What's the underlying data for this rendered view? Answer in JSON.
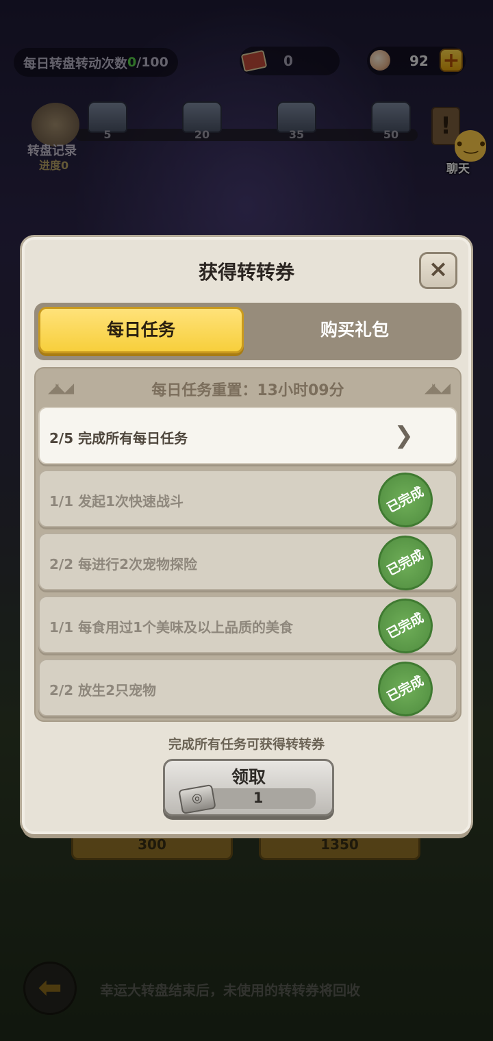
{
  "top_bar": {
    "spin_label": "每日转盘转动次数",
    "spin_current": "0",
    "spin_total": "/100",
    "ticket_count": "0",
    "gem_count": "92",
    "plus_label": "+"
  },
  "progress": {
    "record_label": "转盘记录",
    "record_sub": "进度0",
    "milestones": [
      "5",
      "20",
      "35",
      "50"
    ],
    "quest_icon": "!",
    "chat_label": "聊天"
  },
  "modal": {
    "title": "获得转转券",
    "close_label": "×",
    "tabs": [
      {
        "label": "每日任务",
        "active": true
      },
      {
        "label": "购买礼包",
        "active": false
      }
    ],
    "reset_text": "每日任务重置：13小时09分",
    "tasks": [
      {
        "text": "2/5  完成所有每日任务",
        "status": "arrow"
      },
      {
        "text": "1/1  发起1次快速战斗",
        "status": "已完成"
      },
      {
        "text": "2/2  每进行2次宠物探险",
        "status": "已完成"
      },
      {
        "text": "1/1  每食用过1个美味及以上品质的美食",
        "status": "已完成"
      },
      {
        "text": "2/2  放生2只宠物",
        "status": "已完成"
      }
    ],
    "reward_hint": "完成所有任务可获得转转券",
    "claim_label": "领取",
    "claim_count": "1"
  },
  "background": {
    "prices": [
      "300",
      "1350"
    ],
    "footer_note": "幸运大转盘结束后，未使用的转转券将回收"
  },
  "icons": [
    "ticket-icon",
    "gem-icon",
    "plus-icon",
    "record-icon",
    "chest-icon",
    "quest-icon",
    "chat-icon",
    "close-icon",
    "chevron-right-icon",
    "completed-stamp-icon",
    "back-arrow-icon"
  ]
}
